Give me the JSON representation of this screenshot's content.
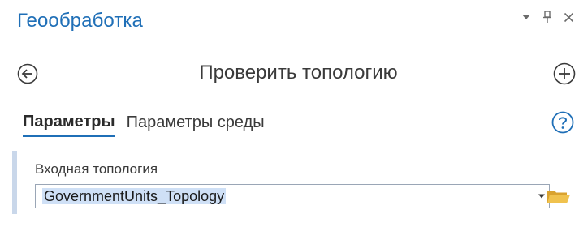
{
  "pane": {
    "title": "Геообработка",
    "controls": {
      "menu_icon": "chevron-down-icon",
      "pin_icon": "pin-icon",
      "close_icon": "close-icon"
    }
  },
  "tool": {
    "title": "Проверить топологию",
    "back_icon": "back-circle-icon",
    "add_icon": "add-circle-icon"
  },
  "tabs": [
    {
      "label": "Параметры",
      "active": true
    },
    {
      "label": "Параметры среды",
      "active": false
    }
  ],
  "help_icon": "help-circle-icon",
  "parameters": {
    "input_topology": {
      "label": "Входная топология",
      "value": "GovernmentUnits_Topology",
      "browse_icon": "folder-icon"
    }
  },
  "colors": {
    "accent": "#1f6fb7",
    "selection": "#cfe0f6",
    "param_accent": "#c9d7ea",
    "folder": "#e9b53c"
  }
}
